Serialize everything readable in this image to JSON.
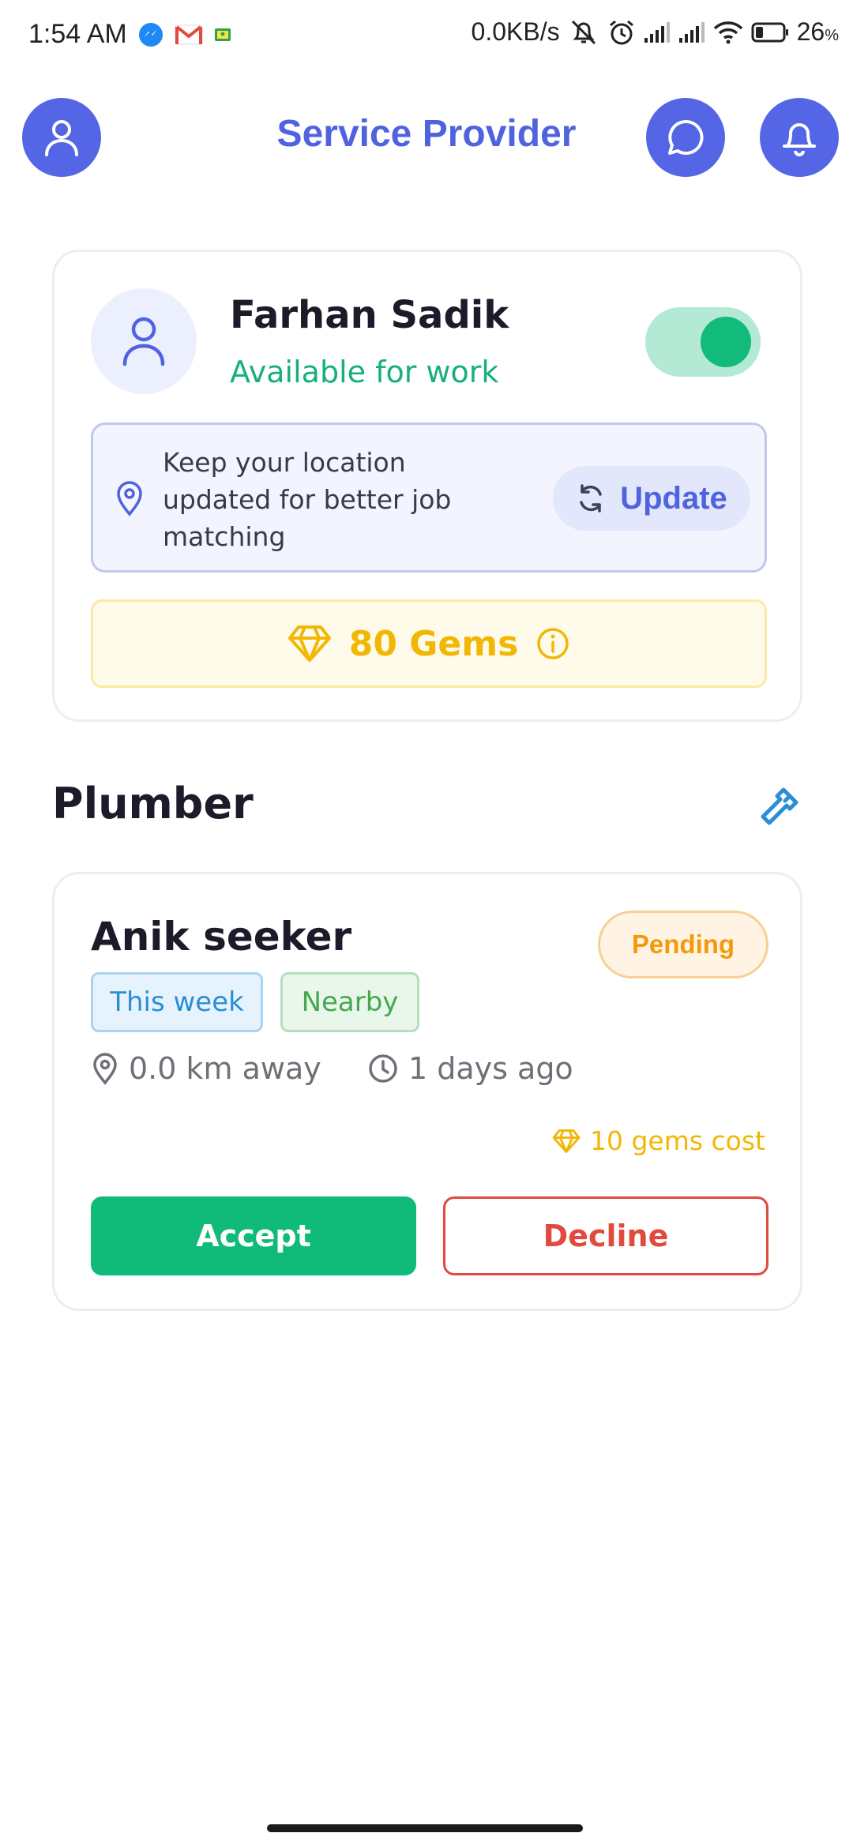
{
  "status_bar": {
    "time": "1:54 AM",
    "network_speed": "0.0KB/s",
    "battery": "26",
    "battery_unit": "%",
    "icons": [
      "messenger-icon",
      "gmail-icon",
      "classroom-icon",
      "mute-icon",
      "alarm-icon",
      "signal-icon",
      "signal-icon",
      "wifi-icon",
      "battery-icon"
    ]
  },
  "header": {
    "title": "Service Provider",
    "left_icon": "user-icon",
    "right_icons": [
      "chat-icon",
      "bell-icon"
    ],
    "accent_color": "#5466e6"
  },
  "profile": {
    "name": "Farhan Sadik",
    "status": "Available for work",
    "available_toggle_on": true,
    "location_message": "Keep your location updated for better job matching",
    "update_label": "Update",
    "gems_label": "80 Gems"
  },
  "section": {
    "title": "Plumber",
    "icon": "wrench-icon"
  },
  "job": {
    "name": "Anik seeker",
    "status": "Pending",
    "tags": [
      "This week",
      "Nearby"
    ],
    "distance": "0.0 km away",
    "posted": "1 days ago",
    "cost": "10 gems cost",
    "accept_label": "Accept",
    "decline_label": "Decline"
  },
  "colors": {
    "primary": "#5466e6",
    "success": "#10bb79",
    "danger": "#e24a3e",
    "gem": "#f2b705",
    "pending": "#f39a0c"
  }
}
